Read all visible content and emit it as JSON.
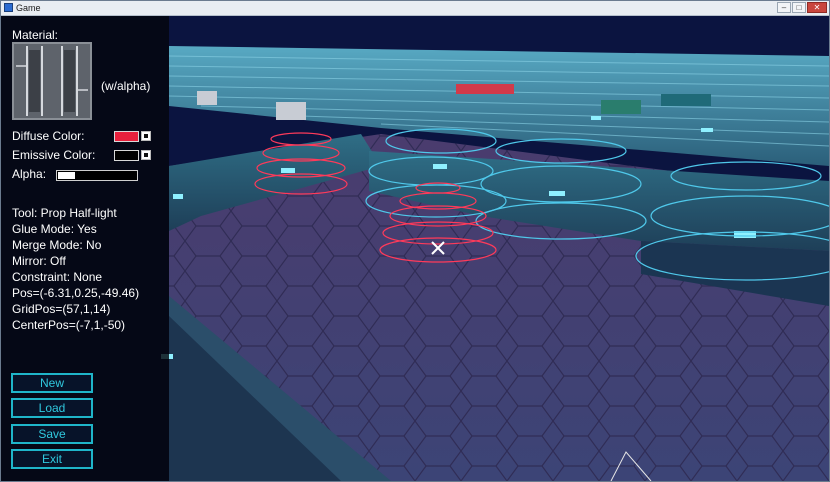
{
  "window": {
    "title": "Game",
    "controls": {
      "minimize": "–",
      "maximize": "□",
      "close": "✕"
    }
  },
  "hud": {
    "material_label": "Material:",
    "alpha_note": "(w/alpha)",
    "diffuse_label": "Diffuse Color:",
    "diffuse_color": "#e8203c",
    "emissive_label": "Emissive Color:",
    "emissive_color": "#000000",
    "alpha_label": "Alpha:",
    "alpha_value": 0.22
  },
  "status": {
    "tool": "Tool: Prop Half-light",
    "glue": "Glue Mode: Yes",
    "merge": "Merge Mode: No",
    "mirror": "Mirror: Off",
    "constraint": "Constraint: None",
    "pos": "Pos=(-6.31,0.25,-49.46)",
    "gridpos": "GridPos=(57,1,14)",
    "centerpos": "CenterPos=(-7,1,-50)"
  },
  "menu": {
    "new": "New",
    "load": "Load",
    "save": "Save",
    "exit": "Exit"
  },
  "colors": {
    "accent": "#1fb5c9",
    "wall_light": "#4aa6c4",
    "floor": "#3a3864",
    "gizmo": "#ff3a5a"
  }
}
